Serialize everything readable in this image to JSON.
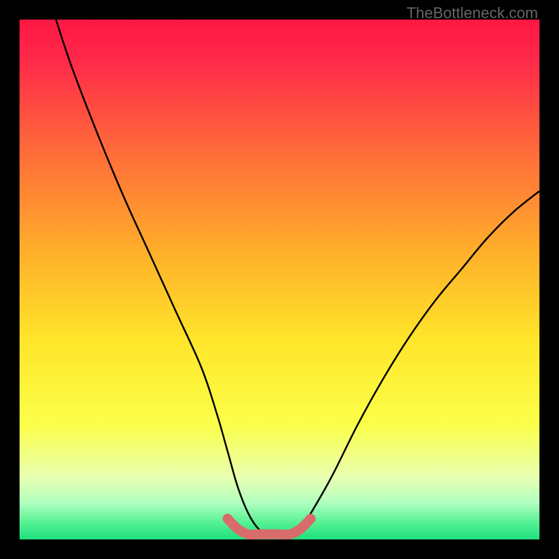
{
  "watermark": "TheBottleneck.com",
  "chart_data": {
    "type": "line",
    "title": "",
    "xlabel": "",
    "ylabel": "",
    "xlim": [
      0,
      100
    ],
    "ylim": [
      0,
      100
    ],
    "series": [
      {
        "name": "curve",
        "x": [
          7,
          10,
          15,
          20,
          25,
          30,
          35,
          38,
          40,
          42,
          44,
          46,
          48,
          50,
          52,
          54,
          56,
          60,
          65,
          70,
          75,
          80,
          85,
          90,
          95,
          100
        ],
        "y": [
          100,
          91,
          78,
          66,
          55,
          44,
          33,
          24,
          17,
          10,
          5,
          2,
          1,
          1,
          1,
          2,
          5,
          12,
          22,
          31,
          39,
          46,
          52,
          58,
          63,
          67
        ]
      }
    ],
    "highlight": {
      "name": "bottleneck-range",
      "x": [
        40,
        42,
        44,
        46,
        48,
        50,
        52,
        54,
        56
      ],
      "y": [
        4,
        2,
        1,
        1,
        1,
        1,
        1,
        2,
        4
      ],
      "color": "#d86b6b"
    },
    "gradient_stops": [
      {
        "offset": 0.0,
        "color": "#ff1744"
      },
      {
        "offset": 0.08,
        "color": "#ff2a4a"
      },
      {
        "offset": 0.25,
        "color": "#ff6a3a"
      },
      {
        "offset": 0.45,
        "color": "#ffb02a"
      },
      {
        "offset": 0.62,
        "color": "#ffe62a"
      },
      {
        "offset": 0.78,
        "color": "#fbff4a"
      },
      {
        "offset": 0.88,
        "color": "#e8ffb0"
      },
      {
        "offset": 0.93,
        "color": "#b0ffc0"
      },
      {
        "offset": 0.97,
        "color": "#50f090"
      },
      {
        "offset": 1.0,
        "color": "#20e080"
      }
    ]
  }
}
